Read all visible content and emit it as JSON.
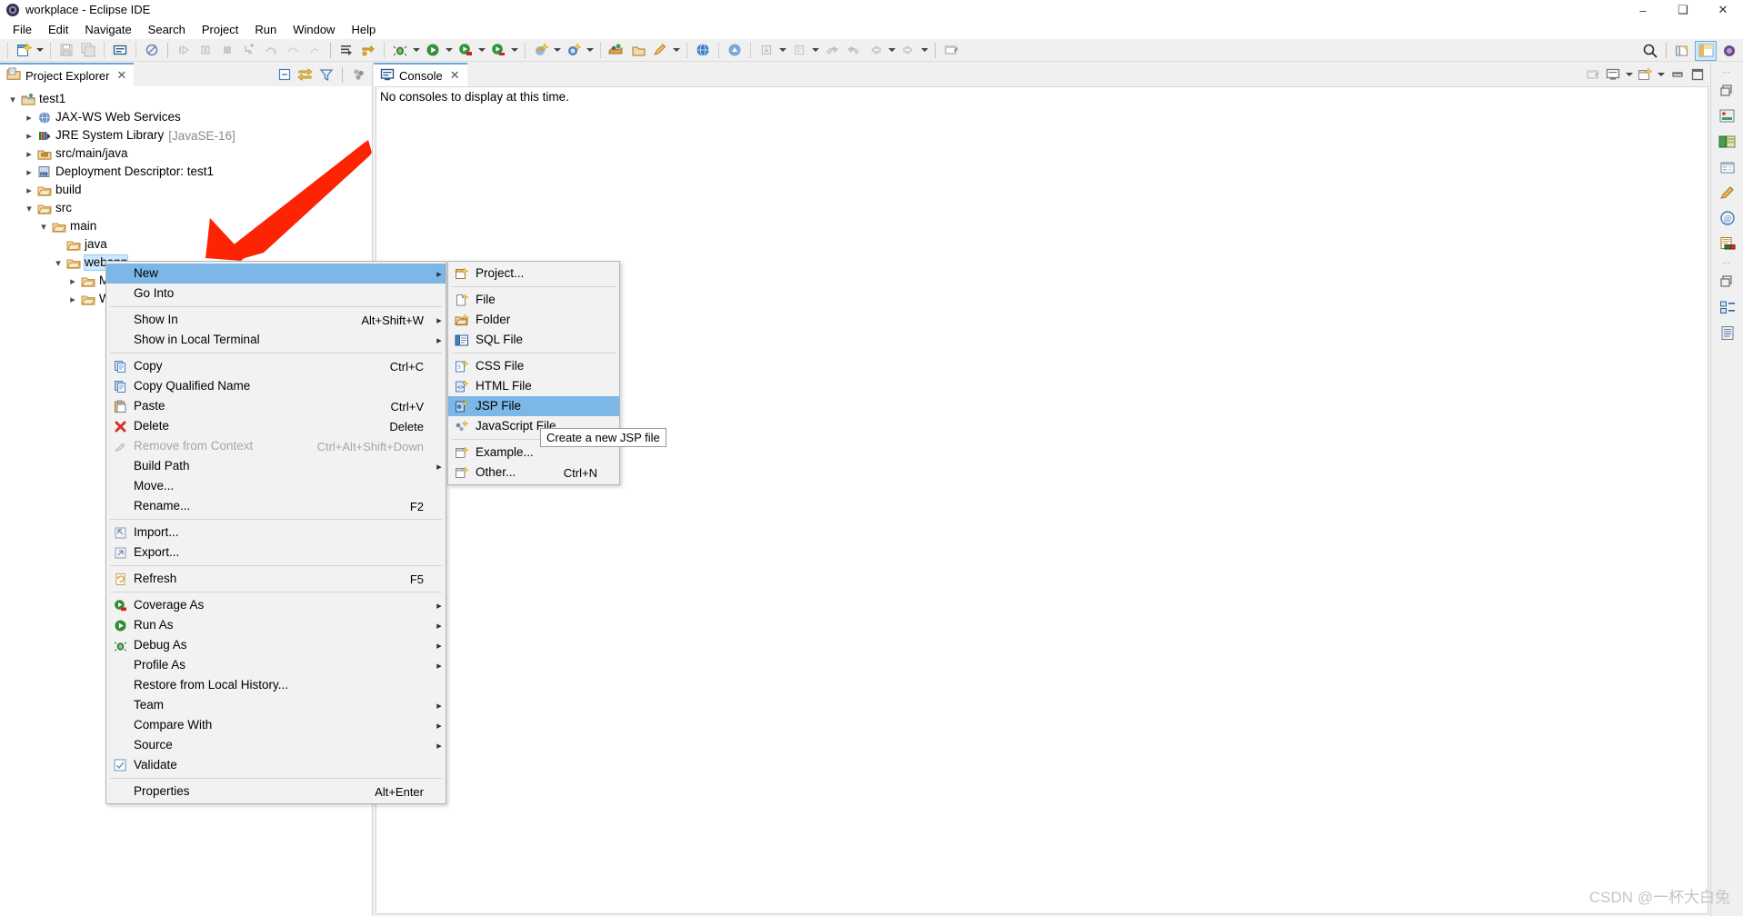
{
  "window": {
    "title": "workplace - Eclipse IDE",
    "app_icon": "eclipse-icon",
    "controls": {
      "minimize": "–",
      "maximize": "❑",
      "close": "✕"
    }
  },
  "menubar": {
    "items": [
      {
        "label": "File",
        "name": "menu-file"
      },
      {
        "label": "Edit",
        "name": "menu-edit"
      },
      {
        "label": "Navigate",
        "name": "menu-navigate"
      },
      {
        "label": "Search",
        "name": "menu-search"
      },
      {
        "label": "Project",
        "name": "menu-project"
      },
      {
        "label": "Run",
        "name": "menu-run"
      },
      {
        "label": "Window",
        "name": "menu-window"
      },
      {
        "label": "Help",
        "name": "menu-help"
      }
    ]
  },
  "toolbar": {
    "buttons": [
      "new-wizard-icon",
      "save-icon",
      "save-all-icon",
      "new-console-icon",
      "no-entry-icon",
      "resume-icon",
      "suspend-icon",
      "terminate-icon",
      "step-into-icon",
      "step-over-icon",
      "step-return-icon",
      "drop-to-frame-icon",
      "skip-breakpoints-icon",
      "toggle-breakpoint-icon",
      "debug-icon",
      "run-icon",
      "coverage-icon",
      "run-as-icon",
      "new-java-project-icon",
      "new-class-icon",
      "new-package-icon",
      "open-type-icon",
      "search-icon",
      "web-browser-icon",
      "external-tools-icon",
      "previous-annotation-icon",
      "next-annotation-icon",
      "last-edit-location-icon",
      "back-icon",
      "forward-icon",
      "pin-editor-icon"
    ],
    "search_placeholder": "",
    "perspectives": [
      "open-perspective-icon",
      "java-ee-perspective-icon",
      "java-perspective-icon"
    ]
  },
  "project_explorer": {
    "tab_label": "Project Explorer",
    "tab_icon": "project-explorer-icon",
    "tab_close": "✕",
    "toolbar": [
      {
        "name": "collapse-all-icon"
      },
      {
        "name": "link-with-editor-icon"
      },
      {
        "name": "view-menu-filter-icon"
      },
      {
        "name": "view-menu-icon"
      }
    ],
    "tree": [
      {
        "name": "tree-item-test1",
        "label": "test1",
        "depth": 0,
        "twist": "expanded",
        "icon": "project-icon",
        "sub": "",
        "selected": false
      },
      {
        "name": "tree-item-jaxws",
        "label": "JAX-WS Web Services",
        "depth": 1,
        "twist": "collapsed",
        "icon": "jaxws-icon",
        "sub": "",
        "selected": false
      },
      {
        "name": "tree-item-jre-system-library",
        "label": "JRE System Library",
        "depth": 1,
        "twist": "collapsed",
        "icon": "library-icon",
        "sub": "[JavaSE-16]",
        "selected": false
      },
      {
        "name": "tree-item-src-main-java",
        "label": "src/main/java",
        "depth": 1,
        "twist": "collapsed",
        "icon": "source-folder-icon",
        "sub": "",
        "selected": false
      },
      {
        "name": "tree-item-deployment-descriptor",
        "label": "Deployment Descriptor: test1",
        "depth": 1,
        "twist": "collapsed",
        "icon": "deployment-descriptor-icon",
        "sub": "",
        "selected": false
      },
      {
        "name": "tree-item-build",
        "label": "build",
        "depth": 1,
        "twist": "collapsed",
        "icon": "folder-icon",
        "sub": "",
        "selected": false
      },
      {
        "name": "tree-item-src",
        "label": "src",
        "depth": 1,
        "twist": "expanded",
        "icon": "folder-icon",
        "sub": "",
        "selected": false
      },
      {
        "name": "tree-item-main",
        "label": "main",
        "depth": 2,
        "twist": "expanded",
        "icon": "folder-icon",
        "sub": "",
        "selected": false
      },
      {
        "name": "tree-item-java",
        "label": "java",
        "depth": 3,
        "twist": "none",
        "icon": "folder-icon",
        "sub": "",
        "selected": false
      },
      {
        "name": "tree-item-webapp",
        "label": "webapp",
        "depth": 3,
        "twist": "expanded",
        "icon": "folder-icon",
        "sub": "",
        "selected": true
      },
      {
        "name": "tree-item-meta-inf",
        "label": "M",
        "depth": 4,
        "twist": "collapsed",
        "icon": "folder-icon",
        "sub": "",
        "selected": false
      },
      {
        "name": "tree-item-web-inf",
        "label": "W",
        "depth": 4,
        "twist": "collapsed",
        "icon": "folder-icon",
        "sub": "",
        "selected": false
      }
    ]
  },
  "console": {
    "tab_label": "Console",
    "tab_icon": "console-icon",
    "tab_close": "✕",
    "empty_message": "No consoles to display at this time.",
    "toolbar": [
      {
        "name": "terminate-console-icon"
      },
      {
        "name": "display-selected-console-icon"
      },
      {
        "name": "display-selected-console-arrow"
      },
      {
        "name": "open-console-icon"
      },
      {
        "name": "open-console-arrow"
      },
      {
        "name": "minimize-icon"
      },
      {
        "name": "maximize-icon"
      }
    ]
  },
  "right_strip": {
    "items": [
      {
        "name": "restore-icon"
      },
      {
        "name": "servers-icon"
      },
      {
        "name": "data-source-explorer-icon"
      },
      {
        "name": "properties-icon"
      },
      {
        "name": "snippets-icon"
      },
      {
        "name": "internet-icon"
      },
      {
        "name": "markers-icon"
      },
      {
        "name": "restore-2-icon"
      },
      {
        "name": "outline-icon"
      },
      {
        "name": "task-list-icon"
      }
    ]
  },
  "context_menu": {
    "items": [
      {
        "name": "ctx-new",
        "label": "New",
        "accel": "",
        "icon": "",
        "arrow": true,
        "highlight": true,
        "disabled": false,
        "sep_after": false
      },
      {
        "name": "ctx-go-into",
        "label": "Go Into",
        "accel": "",
        "icon": "",
        "arrow": false,
        "highlight": false,
        "disabled": false,
        "sep_after": true
      },
      {
        "name": "ctx-show-in",
        "label": "Show In",
        "accel": "Alt+Shift+W",
        "icon": "",
        "arrow": true,
        "highlight": false,
        "disabled": false,
        "sep_after": false
      },
      {
        "name": "ctx-show-in-local-terminal",
        "label": "Show in Local Terminal",
        "accel": "",
        "icon": "",
        "arrow": true,
        "highlight": false,
        "disabled": false,
        "sep_after": true
      },
      {
        "name": "ctx-copy",
        "label": "Copy",
        "accel": "Ctrl+C",
        "icon": "copy-icon",
        "arrow": false,
        "highlight": false,
        "disabled": false,
        "sep_after": false
      },
      {
        "name": "ctx-copy-qualified-name",
        "label": "Copy Qualified Name",
        "accel": "",
        "icon": "copy-qualified-icon",
        "arrow": false,
        "highlight": false,
        "disabled": false,
        "sep_after": false
      },
      {
        "name": "ctx-paste",
        "label": "Paste",
        "accel": "Ctrl+V",
        "icon": "paste-icon",
        "arrow": false,
        "highlight": false,
        "disabled": false,
        "sep_after": false
      },
      {
        "name": "ctx-delete",
        "label": "Delete",
        "accel": "Delete",
        "icon": "delete-icon",
        "arrow": false,
        "highlight": false,
        "disabled": false,
        "sep_after": false
      },
      {
        "name": "ctx-remove-from-context",
        "label": "Remove from Context",
        "accel": "Ctrl+Alt+Shift+Down",
        "icon": "remove-context-icon",
        "arrow": false,
        "highlight": false,
        "disabled": true,
        "sep_after": false
      },
      {
        "name": "ctx-build-path",
        "label": "Build Path",
        "accel": "",
        "icon": "",
        "arrow": true,
        "highlight": false,
        "disabled": false,
        "sep_after": false
      },
      {
        "name": "ctx-move",
        "label": "Move...",
        "accel": "",
        "icon": "",
        "arrow": false,
        "highlight": false,
        "disabled": false,
        "sep_after": false
      },
      {
        "name": "ctx-rename",
        "label": "Rename...",
        "accel": "F2",
        "icon": "",
        "arrow": false,
        "highlight": false,
        "disabled": false,
        "sep_after": true
      },
      {
        "name": "ctx-import",
        "label": "Import...",
        "accel": "",
        "icon": "import-icon",
        "arrow": false,
        "highlight": false,
        "disabled": false,
        "sep_after": false
      },
      {
        "name": "ctx-export",
        "label": "Export...",
        "accel": "",
        "icon": "export-icon",
        "arrow": false,
        "highlight": false,
        "disabled": false,
        "sep_after": true
      },
      {
        "name": "ctx-refresh",
        "label": "Refresh",
        "accel": "F5",
        "icon": "refresh-icon",
        "arrow": false,
        "highlight": false,
        "disabled": false,
        "sep_after": true
      },
      {
        "name": "ctx-coverage-as",
        "label": "Coverage As",
        "accel": "",
        "icon": "coverage-icon",
        "arrow": true,
        "highlight": false,
        "disabled": false,
        "sep_after": false
      },
      {
        "name": "ctx-run-as",
        "label": "Run As",
        "accel": "",
        "icon": "run-icon",
        "arrow": true,
        "highlight": false,
        "disabled": false,
        "sep_after": false
      },
      {
        "name": "ctx-debug-as",
        "label": "Debug As",
        "accel": "",
        "icon": "debug-icon",
        "arrow": true,
        "highlight": false,
        "disabled": false,
        "sep_after": false
      },
      {
        "name": "ctx-profile-as",
        "label": "Profile As",
        "accel": "",
        "icon": "",
        "arrow": true,
        "highlight": false,
        "disabled": false,
        "sep_after": false
      },
      {
        "name": "ctx-restore-from-local-history",
        "label": "Restore from Local History...",
        "accel": "",
        "icon": "",
        "arrow": false,
        "highlight": false,
        "disabled": false,
        "sep_after": false
      },
      {
        "name": "ctx-team",
        "label": "Team",
        "accel": "",
        "icon": "",
        "arrow": true,
        "highlight": false,
        "disabled": false,
        "sep_after": false
      },
      {
        "name": "ctx-compare-with",
        "label": "Compare With",
        "accel": "",
        "icon": "",
        "arrow": true,
        "highlight": false,
        "disabled": false,
        "sep_after": false
      },
      {
        "name": "ctx-source",
        "label": "Source",
        "accel": "",
        "icon": "",
        "arrow": true,
        "highlight": false,
        "disabled": false,
        "sep_after": false
      },
      {
        "name": "ctx-validate",
        "label": "Validate",
        "accel": "",
        "icon": "checkbox-checked-icon",
        "arrow": false,
        "highlight": false,
        "disabled": false,
        "sep_after": true
      },
      {
        "name": "ctx-properties",
        "label": "Properties",
        "accel": "Alt+Enter",
        "icon": "",
        "arrow": false,
        "highlight": false,
        "disabled": false,
        "sep_after": false
      }
    ]
  },
  "new_submenu": {
    "items": [
      {
        "name": "new-project",
        "label": "Project...",
        "accel": "",
        "icon": "new-project-icon",
        "highlight": false,
        "sep_after": true
      },
      {
        "name": "new-file",
        "label": "File",
        "accel": "",
        "icon": "new-file-icon",
        "highlight": false,
        "sep_after": false
      },
      {
        "name": "new-folder",
        "label": "Folder",
        "accel": "",
        "icon": "new-folder-icon",
        "highlight": false,
        "sep_after": false
      },
      {
        "name": "new-sql-file",
        "label": "SQL File",
        "accel": "",
        "icon": "sql-file-icon",
        "highlight": false,
        "sep_after": true
      },
      {
        "name": "new-css-file",
        "label": "CSS File",
        "accel": "",
        "icon": "css-file-icon",
        "highlight": false,
        "sep_after": false
      },
      {
        "name": "new-html-file",
        "label": "HTML File",
        "accel": "",
        "icon": "html-file-icon",
        "highlight": false,
        "sep_after": false
      },
      {
        "name": "new-jsp-file",
        "label": "JSP File",
        "accel": "",
        "icon": "jsp-file-icon",
        "highlight": true,
        "sep_after": false
      },
      {
        "name": "new-javascript-file",
        "label": "JavaScript File",
        "accel": "",
        "icon": "javascript-file-icon",
        "highlight": false,
        "sep_after": true
      },
      {
        "name": "new-example",
        "label": "Example...",
        "accel": "",
        "icon": "example-icon",
        "highlight": false,
        "sep_after": false
      },
      {
        "name": "new-other",
        "label": "Other...",
        "accel": "Ctrl+N",
        "icon": "other-icon",
        "highlight": false,
        "sep_after": false
      }
    ]
  },
  "tooltip": {
    "text": "Create a new JSP file"
  },
  "annotation": {
    "arrow_color": "#fc2403"
  },
  "watermark": {
    "text": "CSDN @一杯大白兔"
  },
  "colors": {
    "accent": "#7cb7e8",
    "selection": "#cde8ff",
    "menu_bg": "#f2f2f2",
    "panel_bg": "#f0f0f0",
    "arrow_red": "#fc2403"
  }
}
